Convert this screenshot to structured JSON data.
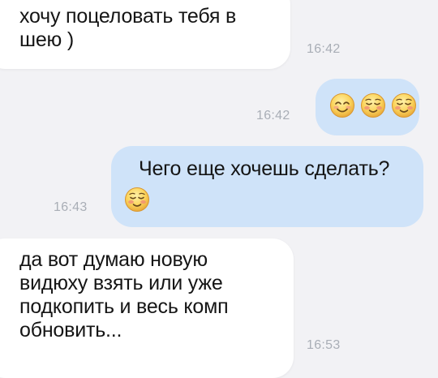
{
  "messages": [
    {
      "direction": "incoming",
      "text": "хочу поцеловать тебя в\nшею )",
      "time": "16:42"
    },
    {
      "direction": "outgoing",
      "emojis": [
        "smiling-face-with-smiling-eyes-icon",
        "blushing-face-icon",
        "blushing-face-icon"
      ],
      "time": "16:42"
    },
    {
      "direction": "outgoing",
      "text": "Чего еще хочешь сделать?",
      "emojis": [
        "blushing-face-icon"
      ],
      "time": "16:43"
    },
    {
      "direction": "incoming",
      "text": "да вот думаю новую\nвидюху взять или уже\nподкопить и весь комп\nобновить...",
      "time": "16:53"
    }
  ],
  "colors": {
    "background": "#f2f2f5",
    "incoming_bubble": "#ffffff",
    "outgoing_bubble": "#cfe3f9",
    "text": "#151515",
    "timestamp": "#a9aeb6",
    "emoji_face": "#fbd45c"
  }
}
